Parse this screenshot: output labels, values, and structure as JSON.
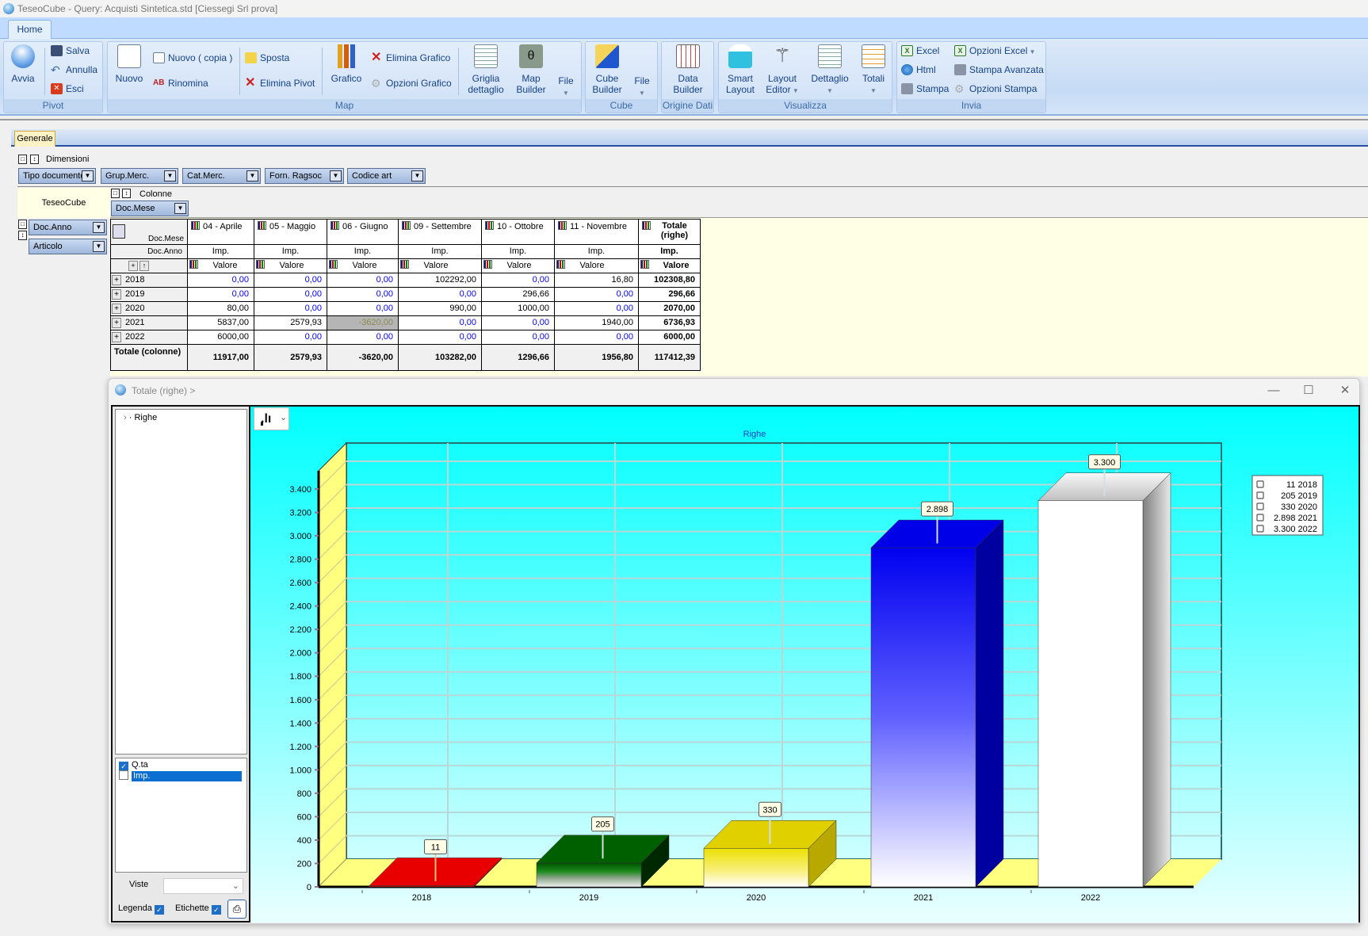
{
  "window": {
    "title": "TeseoCube - Query: Acquisti Sintetica.std [Ciessegi Srl prova]"
  },
  "ribbon": {
    "tab": "Home",
    "groups": {
      "pivot": "Pivot",
      "map": "Map",
      "cube": "Cube",
      "origine": "Origine Dati",
      "visualizza": "Visualizza",
      "invia": "Invia"
    },
    "buttons": {
      "avvia": "Avvia",
      "salva": "Salva",
      "annulla": "Annulla",
      "esci": "Esci",
      "nuovo": "Nuovo",
      "nuovo_copia": "Nuovo ( copia )",
      "rinomina": "Rinomina",
      "sposta": "Sposta",
      "elimina_pivot": "Elimina Pivot",
      "grafico": "Grafico",
      "elimina_grafico": "Elimina Grafico",
      "opzioni_grafico": "Opzioni Grafico",
      "griglia_1": "Griglia",
      "griglia_2": "dettaglio",
      "map_1": "Map",
      "map_2": "Builder",
      "file": "File",
      "cube_1": "Cube",
      "cube_2": "Builder",
      "file2": "File",
      "data_1": "Data",
      "data_2": "Builder",
      "smart_1": "Smart",
      "smart_2": "Layout",
      "layout_1": "Layout",
      "layout_2": "Editor",
      "dettaglio": "Dettaglio",
      "totali": "Totali",
      "excel": "Excel",
      "html": "Html",
      "stampa": "Stampa",
      "opzioni_excel": "Opzioni Excel",
      "stampa_avanzata": "Stampa Avanzata",
      "opzioni_stampa": "Opzioni Stampa"
    }
  },
  "pivot": {
    "tab": "Generale",
    "dimensioni_label": "Dimensioni",
    "dimensions": [
      "Tipo documento",
      "Grup.Merc.",
      "Cat.Merc.",
      "Forn. Ragsoc",
      "Codice art"
    ],
    "corner_label": "TeseoCube",
    "colonne_label": "Colonne",
    "column_field": "Doc.Mese",
    "row_fields": [
      "Doc.Anno",
      "Articolo"
    ],
    "corner_col_label": "Doc.Mese",
    "corner_row_label": "Doc.Anno",
    "columns": [
      "04 - Aprile",
      "05 - Maggio",
      "06 - Giugno",
      "09 - Settembre",
      "10 - Ottobre",
      "11 - Novembre"
    ],
    "total_column": "Totale (righe)",
    "measure": "Imp.",
    "value_label": "Valore",
    "rows": [
      {
        "label": "2018",
        "values": [
          "0,00",
          "0,00",
          "0,00",
          "102292,00",
          "0,00",
          "16,80"
        ],
        "total": "102308,80"
      },
      {
        "label": "2019",
        "values": [
          "0,00",
          "0,00",
          "0,00",
          "0,00",
          "296,66",
          "0,00"
        ],
        "total": "296,66"
      },
      {
        "label": "2020",
        "values": [
          "80,00",
          "0,00",
          "0,00",
          "990,00",
          "1000,00",
          "0,00"
        ],
        "total": "2070,00"
      },
      {
        "label": "2021",
        "values": [
          "5837,00",
          "2579,93",
          "-3620,00",
          "0,00",
          "0,00",
          "1940,00"
        ],
        "total": "6736,93"
      },
      {
        "label": "2022",
        "values": [
          "6000,00",
          "0,00",
          "0,00",
          "0,00",
          "0,00",
          "0,00"
        ],
        "total": "6000,00"
      }
    ],
    "total_row": {
      "label": "Totale (colonne)",
      "values": [
        "11917,00",
        "2579,93",
        "-3620,00",
        "103282,00",
        "1296,66",
        "1956,80"
      ],
      "total": "117412,39"
    },
    "highlighted_cell": {
      "row": 3,
      "col": 2
    }
  },
  "chart_window": {
    "title": "Totale (righe) >",
    "tree_item": "Righe",
    "measures": [
      {
        "label": "Q.ta",
        "checked": true
      },
      {
        "label": "Imp.",
        "checked": false,
        "selected": true
      }
    ],
    "viste_label": "Viste",
    "viste_value": "",
    "legenda_label": "Legenda",
    "legenda_checked": true,
    "etichette_label": "Etichette",
    "etichette_checked": true
  },
  "chart_data": {
    "type": "bar",
    "style": "3d",
    "title": "Righe",
    "categories": [
      "2018",
      "2019",
      "2020",
      "2021",
      "2022"
    ],
    "values": [
      11,
      205,
      330,
      2898,
      3300
    ],
    "data_labels": [
      "11",
      "205",
      "330",
      "2.898",
      "3.300"
    ],
    "ylim": [
      0,
      3400
    ],
    "yticks": [
      "0",
      "200",
      "400",
      "600",
      "800",
      "1.000",
      "1.200",
      "1.400",
      "1.600",
      "1.800",
      "2.000",
      "2.200",
      "2.400",
      "2.600",
      "2.800",
      "3.000",
      "3.200",
      "3.400"
    ],
    "grid": true,
    "legend_position": "right",
    "legend": [
      "11 2018",
      "205 2019",
      "330 2020",
      "2.898 2021",
      "3.300 2022"
    ],
    "colors": [
      "#e00000",
      "#006400",
      "#f0e000",
      "#0000ff",
      "#ffffff"
    ],
    "background": "#00ffff",
    "wall_color": "#ffff80"
  }
}
